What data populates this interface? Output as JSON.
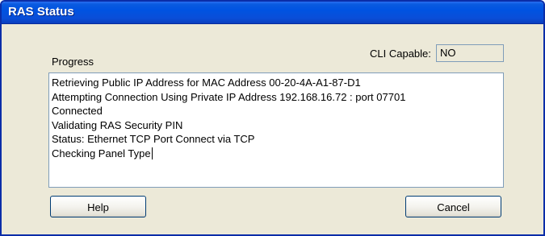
{
  "window": {
    "title": "RAS Status"
  },
  "progress": {
    "label": "Progress",
    "lines": [
      "Retrieving Public IP Address for MAC Address 00-20-4A-A1-87-D1",
      "Attempting Connection Using Private IP Address 192.168.16.72 : port 07701",
      "Connected",
      "Validating RAS Security PIN",
      "Status: Ethernet TCP Port Connect via TCP",
      "Checking Panel Type"
    ]
  },
  "cli": {
    "label": "CLI Capable:",
    "value": "NO"
  },
  "buttons": {
    "help": "Help",
    "cancel": "Cancel"
  },
  "colors": {
    "titlebar": "#0053e1",
    "window_bg": "#ece9d8",
    "border": "#7f9db9"
  }
}
